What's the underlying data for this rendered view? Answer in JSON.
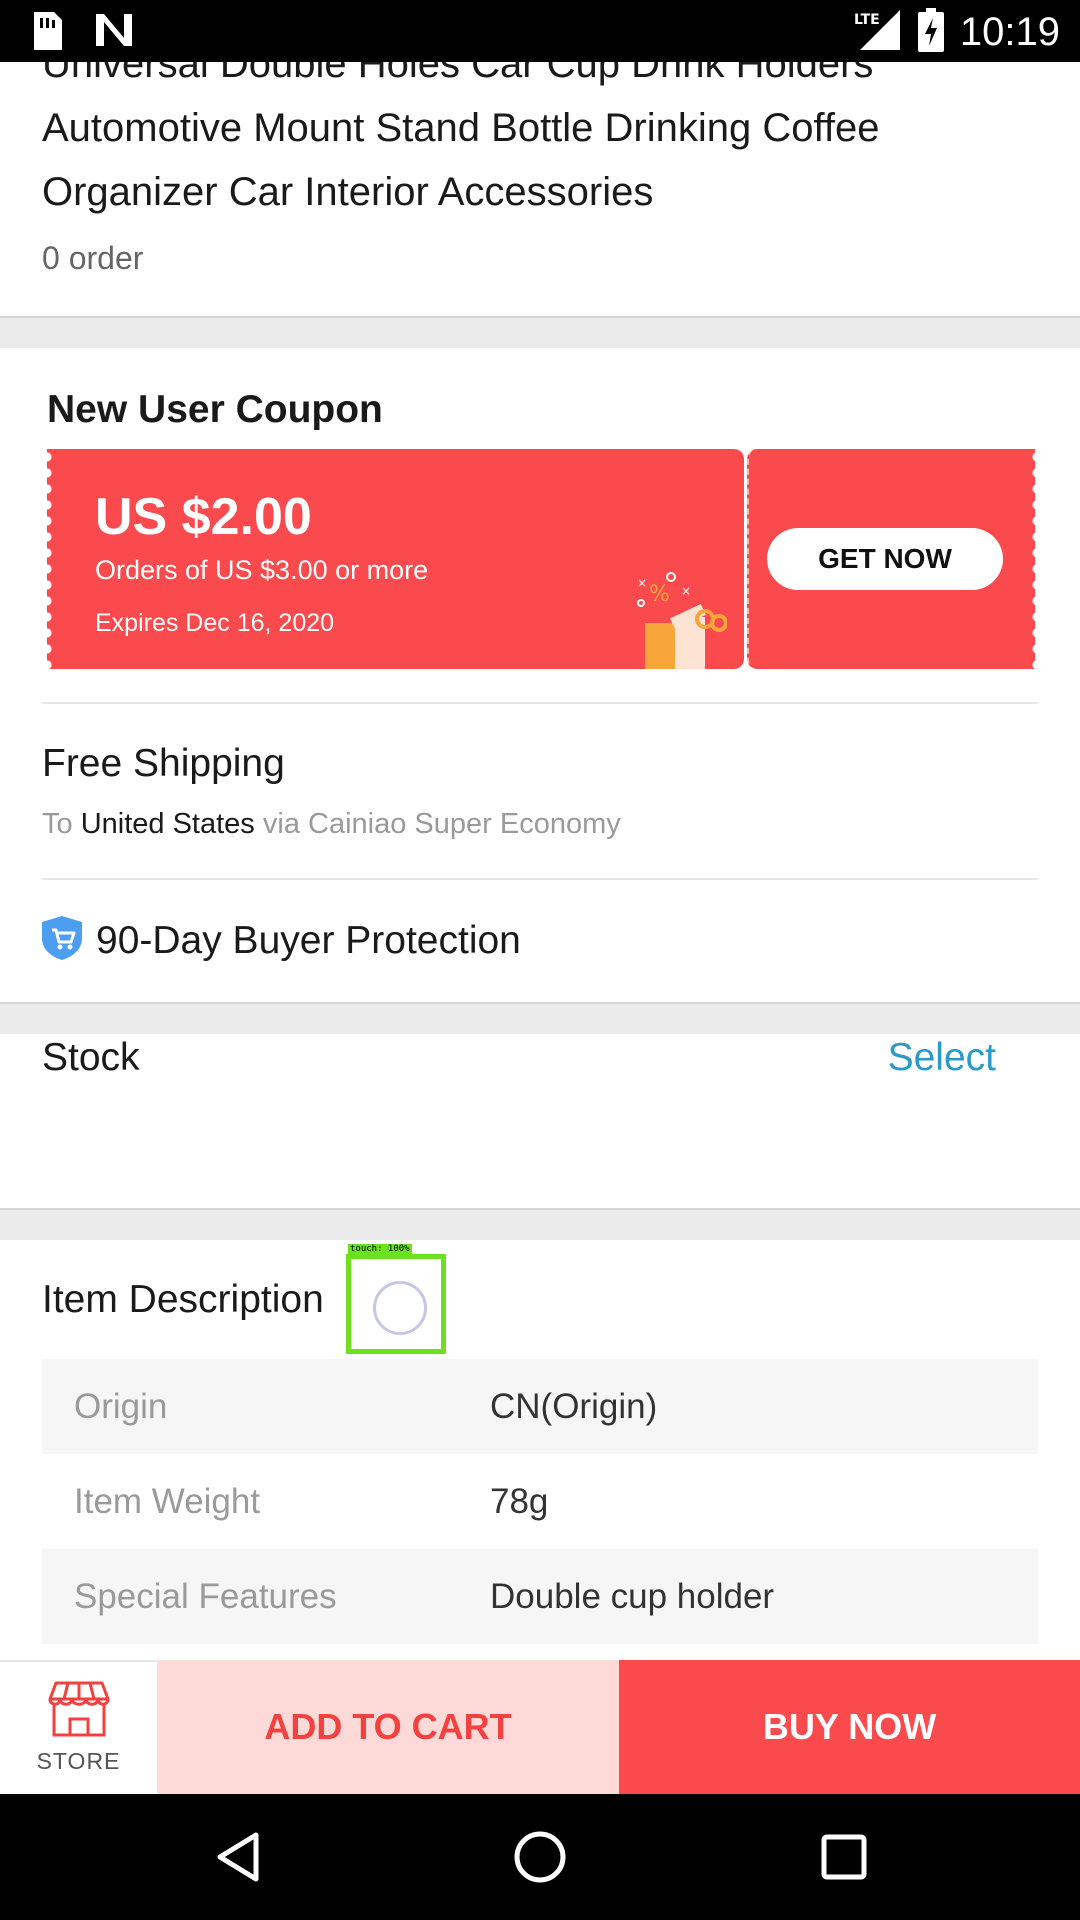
{
  "status_bar": {
    "time": "10:19",
    "network": "LTE",
    "icons": [
      "sim-card-icon",
      "n-logo-icon",
      "lte-signal-icon",
      "battery-charging-icon"
    ]
  },
  "product": {
    "title": "Universal Double Holes Car Cup Drink Holders Automotive Mount Stand Bottle Drinking Coffee Organizer Car Interior Accessories",
    "orders": "0 order"
  },
  "coupon": {
    "section_title": "New User Coupon",
    "amount": "US $2.00",
    "condition": "Orders of US $3.00 or more",
    "expires": "Expires Dec 16, 2020",
    "button_label": "GET NOW",
    "color": "#fa4a4d"
  },
  "shipping": {
    "title": "Free Shipping",
    "prefix": "To",
    "destination": "United States",
    "suffix": "via Cainiao Super Economy"
  },
  "protection": {
    "label": "90-Day Buyer Protection",
    "icon": "shield-cart-icon"
  },
  "stock": {
    "label": "Stock",
    "action": "Select",
    "action_color": "#2a9ac9"
  },
  "description": {
    "title": "Item Description",
    "specs": [
      {
        "key": "Origin",
        "value": "CN(Origin)"
      },
      {
        "key": "Item Weight",
        "value": "78g"
      },
      {
        "key": "Special Features",
        "value": "Double cup holder"
      }
    ]
  },
  "touch_indicator": {
    "label": "touch: 100%"
  },
  "action_bar": {
    "store_label": "STORE",
    "add_to_cart_label": "ADD TO CART",
    "buy_now_label": "BUY NOW",
    "accent": "#fa4a4d"
  },
  "nav_bar": {
    "icons": [
      "back-icon",
      "home-icon",
      "recents-icon"
    ]
  }
}
